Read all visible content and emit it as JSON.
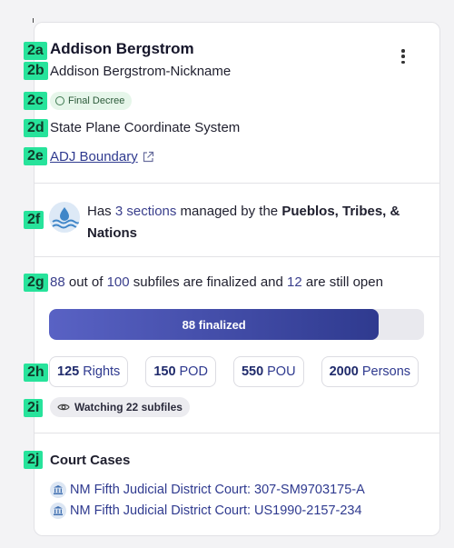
{
  "annotations": [
    "2a",
    "2b",
    "2c",
    "2d",
    "2e",
    "2f",
    "2g",
    "2h",
    "2i",
    "2j"
  ],
  "header": {
    "name": "Addison Bergstrom",
    "nickname": "Addison Bergstrom-Nickname",
    "status_badge": "Final Decree",
    "coordinate_system": "State Plane Coordinate System",
    "boundary_link": "ADJ Boundary",
    "menu_icon": "more-vertical-icon"
  },
  "management": {
    "icon": "water-icon",
    "prefix": "Has ",
    "count_text": "3 sections",
    "middle": " managed by the ",
    "entity": "Pueblos, Tribes, & Nations"
  },
  "subfiles": {
    "finalized": "88",
    "text1": " out of ",
    "total": "100",
    "text2": " subfiles are finalized and ",
    "open": "12",
    "text3": " are still open",
    "progress_label": "88 finalized",
    "progress_fraction": 0.88
  },
  "stats": [
    {
      "value": "125",
      "label": "Rights"
    },
    {
      "value": "150",
      "label": "POD"
    },
    {
      "value": "550",
      "label": "POU"
    },
    {
      "value": "2000",
      "label": "Persons"
    }
  ],
  "watching": "Watching 22 subfiles",
  "court_cases": {
    "title": "Court Cases",
    "items": [
      "NM Fifth Judicial District Court: 307-SM9703175-A",
      "NM Fifth Judicial District Court: US1990-2157-234"
    ]
  },
  "colors": {
    "accent": "#2f3a8f",
    "annotation": "#27e39b",
    "badge_bg": "#e6f6ea",
    "progress_track": "#e9e9ee"
  }
}
